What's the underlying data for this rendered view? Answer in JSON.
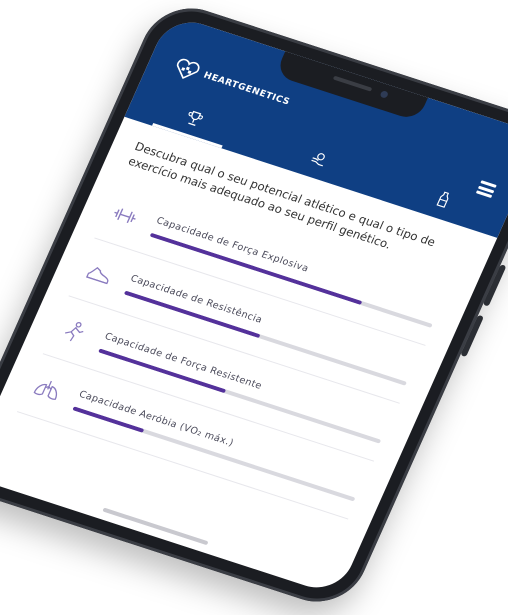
{
  "app": {
    "logo_text": "HEARTGENETICS",
    "brand_color": "#0f3f83",
    "accent_color": "#54319b"
  },
  "tabs": [
    {
      "name": "tab-trophy",
      "icon": "trophy-icon",
      "active": true
    },
    {
      "name": "tab-nutrition",
      "icon": "hand-apple-icon",
      "active": false
    },
    {
      "name": "tab-drink",
      "icon": "bottle-icon",
      "active": false
    }
  ],
  "intro": "Descubra qual o seu potencial atlético e qual o tipo de exercício mais adequado ao seu perfil genético.",
  "capacities": [
    {
      "label": "Capacidade de Força Explosiva",
      "icon": "dumbbell-icon",
      "level": 0.75
    },
    {
      "label": "Capacidade de Resistência",
      "icon": "running-shoe-icon",
      "level": 0.48
    },
    {
      "label": "Capacidade de Força Resistente",
      "icon": "runner-icon",
      "level": 0.45
    },
    {
      "label": "Capacidade Aeróbia (VO₂ máx.)",
      "icon": "lungs-icon",
      "level": 0.25
    }
  ]
}
